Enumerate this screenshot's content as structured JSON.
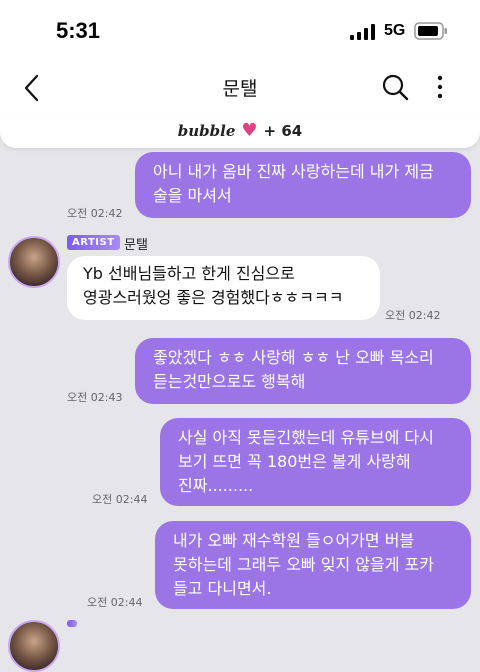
{
  "status_bar": {
    "time": "5:31",
    "network": "5G"
  },
  "header": {
    "title": "문탤"
  },
  "bubble_bar": {
    "brand": "bubble",
    "count": "+ 64"
  },
  "artist": {
    "badge": "ARTIST",
    "name": "문탤"
  },
  "messages": [
    {
      "text": "아니 내가 옴바 진짜 사랑하는데 내가 제금\n술을 마셔서",
      "time": "오전 02:42"
    },
    {
      "text": "Yb 선배님들하고 한게 진심으로\n영광스러웠엉 좋은 경험했다ㅎㅎㅋㅋㅋ",
      "time": "오전 02:42"
    },
    {
      "text": "좋았겠다 ㅎㅎ 사랑해 ㅎㅎ 난 오빠 목소리\n듣는것만으로도 행복해",
      "time": "오전 02:43"
    },
    {
      "text": "사실 아직 못듣긴했는데 유튜브에 다시\n보기 뜨면 꼭 180번은 볼게 사랑해\n진짜.........",
      "time": "오전 02:44"
    },
    {
      "text": "내가 오빠 재수학원 들ㅇ어가면 버블\n못하는데 그래두 오빠 잊지 않을게 포카\n들고 다니면서.",
      "time": "오전 02:44"
    }
  ],
  "colors": {
    "accent": "#9b75e6",
    "background": "#e6e6ea",
    "heart": "#e0417f"
  },
  "icons": [
    "back-icon",
    "search-icon",
    "more-icon",
    "heart-icon",
    "signal-icon",
    "battery-icon"
  ]
}
